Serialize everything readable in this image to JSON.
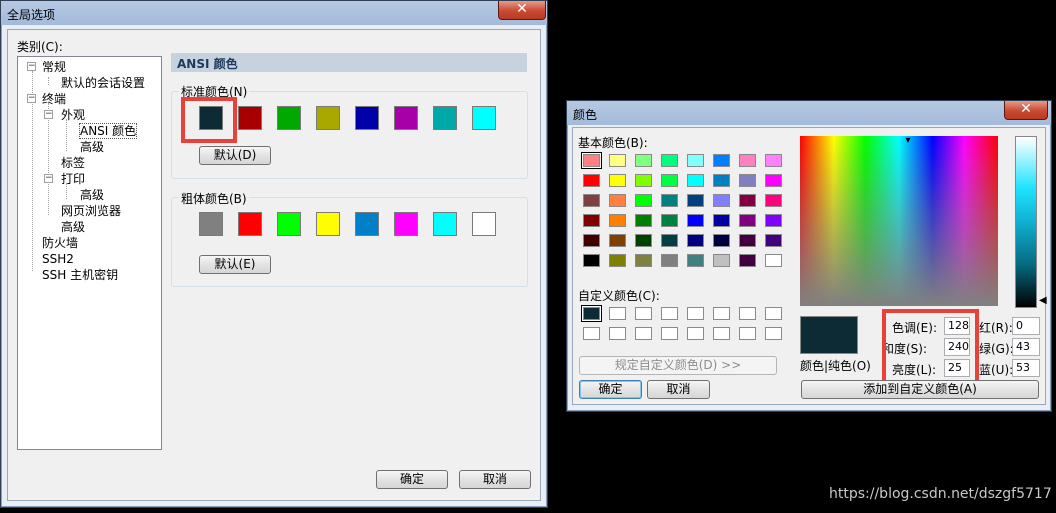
{
  "global_options": {
    "title": "全局选项",
    "close": "✕",
    "category_label": "类别(C):",
    "tree": [
      {
        "label": "常规",
        "toggle": "−"
      },
      {
        "label": "默认的会话设置"
      },
      {
        "label": "终端",
        "toggle": "−"
      },
      {
        "label": "外观",
        "toggle": "−"
      },
      {
        "label": "ANSI 颜色",
        "selected": true
      },
      {
        "label": "高级"
      },
      {
        "label": "标签"
      },
      {
        "label": "打印",
        "toggle": "−"
      },
      {
        "label": "高级"
      },
      {
        "label": "网页浏览器"
      },
      {
        "label": "高级"
      },
      {
        "label": "防火墙"
      },
      {
        "label": "SSH2"
      },
      {
        "label": "SSH 主机密钥"
      }
    ],
    "section_title": "ANSI 颜色",
    "standard_colors": {
      "label": "标准颜色(N)",
      "swatches": [
        "#0c2b35",
        "#a80000",
        "#00a800",
        "#a8a800",
        "#0000a8",
        "#a800a8",
        "#00a8a8",
        "#00ffff"
      ],
      "default_button": "默认(D)"
    },
    "bold_colors": {
      "label": "粗体颜色(B)",
      "swatches": [
        "#808080",
        "#ff0000",
        "#00ff00",
        "#ffff00",
        "#0080c8",
        "#ff00ff",
        "#00ffff",
        "#ffffff"
      ],
      "default_button": "默认(E)"
    },
    "ok_button": "确定",
    "cancel_button": "取消"
  },
  "color_dialog": {
    "title": "颜色",
    "close": "✕",
    "basic_colors_label": "基本颜色(B):",
    "basic_colors": [
      [
        "#ff8080",
        "#ffff80",
        "#80ff80",
        "#00ff80",
        "#80ffff",
        "#0080ff",
        "#ff80c0",
        "#ff80ff"
      ],
      [
        "#ff0000",
        "#ffff00",
        "#80ff00",
        "#00ff40",
        "#00ffff",
        "#0080c0",
        "#8080c0",
        "#ff00ff"
      ],
      [
        "#804040",
        "#ff8040",
        "#00ff00",
        "#008080",
        "#004080",
        "#8080ff",
        "#800040",
        "#ff0080"
      ],
      [
        "#800000",
        "#ff8000",
        "#008000",
        "#008040",
        "#0000ff",
        "#0000a0",
        "#800080",
        "#8000ff"
      ],
      [
        "#400000",
        "#804000",
        "#004000",
        "#004040",
        "#000080",
        "#000040",
        "#400040",
        "#400080"
      ],
      [
        "#000000",
        "#808000",
        "#808040",
        "#808080",
        "#408080",
        "#c0c0c0",
        "#400040",
        "#ffffff"
      ]
    ],
    "custom_colors_label": "自定义颜色(C):",
    "custom_colors": [
      [
        "#0c2b35",
        "#ffffff",
        "#ffffff",
        "#ffffff",
        "#ffffff",
        "#ffffff",
        "#ffffff",
        "#ffffff"
      ],
      [
        "#ffffff",
        "#ffffff",
        "#ffffff",
        "#ffffff",
        "#ffffff",
        "#ffffff",
        "#ffffff",
        "#ffffff"
      ]
    ],
    "define_custom_button": "规定自定义颜色(D) >>",
    "ok_button": "确定",
    "cancel_button": "取消",
    "preview_color": "#0c2b35",
    "preview_label": "颜色|纯色(O)",
    "hue_label": "色调(E):",
    "hue_value": "128",
    "sat_label": "和度(S):",
    "sat_value": "240",
    "lum_label": "亮度(L):",
    "lum_value": "25",
    "red_label": "红(R):",
    "red_value": "0",
    "green_label": "绿(G):",
    "green_value": "43",
    "blue_label": "蓝(U):",
    "blue_value": "53",
    "add_custom_button": "添加到自定义颜色(A)"
  },
  "watermark": "https://blog.csdn.net/dszgf5717"
}
